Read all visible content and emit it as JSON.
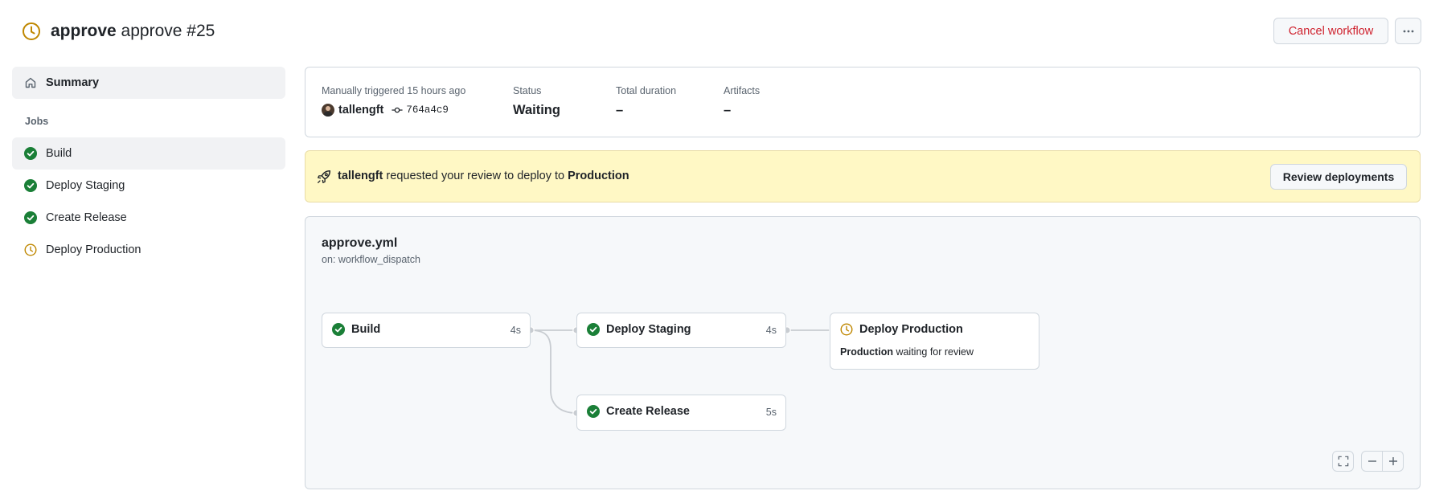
{
  "header": {
    "workflow_name": "approve",
    "run_title": "approve #25",
    "cancel_label": "Cancel workflow",
    "more_icon": "kebab-horizontal-icon",
    "status_icon": "clock-icon"
  },
  "sidebar": {
    "summary_label": "Summary",
    "jobs_heading": "Jobs",
    "jobs": [
      {
        "label": "Build",
        "status": "success"
      },
      {
        "label": "Deploy Staging",
        "status": "success"
      },
      {
        "label": "Create Release",
        "status": "success"
      },
      {
        "label": "Deploy Production",
        "status": "waiting"
      }
    ]
  },
  "summary": {
    "trigger_label": "Manually triggered 15 hours ago",
    "actor": "tallengft",
    "commit": "764a4c9",
    "status_label": "Status",
    "status_value": "Waiting",
    "duration_label": "Total duration",
    "duration_value": "–",
    "artifacts_label": "Artifacts",
    "artifacts_value": "–"
  },
  "review_banner": {
    "actor": "tallengft",
    "text_middle": "requested your review to deploy to",
    "environment": "Production",
    "button_label": "Review deployments"
  },
  "graph": {
    "file_name": "approve.yml",
    "trigger": "on: workflow_dispatch",
    "nodes": [
      {
        "name": "Build",
        "duration": "4s",
        "status": "success"
      },
      {
        "name": "Deploy Staging",
        "duration": "4s",
        "status": "success"
      },
      {
        "name": "Deploy Production",
        "duration": "",
        "status": "waiting",
        "note_env": "Production",
        "note_text": "waiting for review"
      },
      {
        "name": "Create Release",
        "duration": "5s",
        "status": "success"
      }
    ]
  },
  "colors": {
    "success": "#1a7f37",
    "waiting": "#bf8700",
    "danger": "#cf222e",
    "banner_bg": "#fff8c5"
  }
}
